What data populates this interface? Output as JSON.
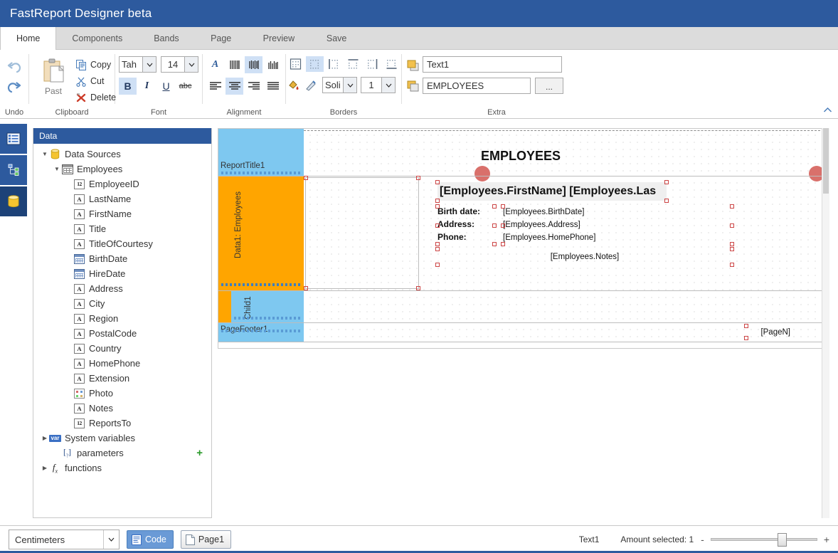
{
  "window": {
    "title": "FastReport Designer beta"
  },
  "tabs": [
    {
      "label": "Home",
      "active": true
    },
    {
      "label": "Components",
      "active": false
    },
    {
      "label": "Bands",
      "active": false
    },
    {
      "label": "Page",
      "active": false
    },
    {
      "label": "Preview",
      "active": false
    },
    {
      "label": "Save",
      "active": false
    }
  ],
  "ribbon": {
    "groups": {
      "undo": {
        "label": "Undo",
        "undo_icon": "undo-arrow-icon",
        "redo_icon": "redo-arrow-icon"
      },
      "clipboard": {
        "label": "Clipboard",
        "paste_label": "Past",
        "items": [
          {
            "label": "Copy",
            "icon": "copy-icon"
          },
          {
            "label": "Cut",
            "icon": "scissors-icon"
          },
          {
            "label": "Delete",
            "icon": "delete-x-icon"
          }
        ]
      },
      "font": {
        "label": "Font",
        "family_value": "Tah",
        "size_value": "14",
        "bold_label": "B",
        "italic_label": "I",
        "underline_label": "U",
        "strike_label": "abc",
        "bold_active": true
      },
      "alignment": {
        "label": "Alignment",
        "rotate_label": "A",
        "vertical": [
          {
            "name": "align-top-icon",
            "active": false
          },
          {
            "name": "align-middle-icon",
            "active": true
          },
          {
            "name": "align-bottom-icon",
            "active": false
          }
        ],
        "horizontal": [
          {
            "name": "align-left-icon",
            "active": false
          },
          {
            "name": "align-center-icon",
            "active": true
          },
          {
            "name": "align-right-icon",
            "active": false
          },
          {
            "name": "align-justify-icon",
            "active": false
          }
        ]
      },
      "borders": {
        "label": "Borders",
        "buttons": [
          {
            "name": "border-all-icon",
            "active": false
          },
          {
            "name": "border-none-icon",
            "active": true
          },
          {
            "name": "border-left-icon",
            "active": false
          },
          {
            "name": "border-top-icon",
            "active": false
          },
          {
            "name": "border-right-icon",
            "active": false
          },
          {
            "name": "border-bottom-icon",
            "active": false
          }
        ],
        "fill_icon": "fill-color-icon",
        "line_color_icon": "line-color-icon",
        "style_value": "Soli",
        "width_value": "1"
      },
      "extra": {
        "label": "Extra",
        "bring_front_icon": "bring-to-front-icon",
        "send_back_icon": "send-to-back-icon",
        "name_value": "Text1",
        "text_value": "EMPLOYEES",
        "ellipsis_label": "..."
      }
    },
    "collapse_icon": "chevron-up-icon"
  },
  "left_strip": [
    {
      "name": "properties-panel-icon",
      "selected": false
    },
    {
      "name": "report-tree-icon",
      "selected": false
    },
    {
      "name": "data-panel-icon",
      "selected": true
    }
  ],
  "data_panel": {
    "header": "Data",
    "tree": [
      {
        "label": "Data Sources",
        "indent": 0,
        "twisty": "down",
        "icon": "database-icon"
      },
      {
        "label": "Employees",
        "indent": 1,
        "twisty": "down",
        "icon": "table-icon"
      },
      {
        "label": "EmployeeID",
        "indent": 2,
        "twisty": "",
        "icon": "number-field-icon"
      },
      {
        "label": "LastName",
        "indent": 2,
        "twisty": "",
        "icon": "text-field-icon"
      },
      {
        "label": "FirstName",
        "indent": 2,
        "twisty": "",
        "icon": "text-field-icon"
      },
      {
        "label": "Title",
        "indent": 2,
        "twisty": "",
        "icon": "text-field-icon"
      },
      {
        "label": "TitleOfCourtesy",
        "indent": 2,
        "twisty": "",
        "icon": "text-field-icon"
      },
      {
        "label": "BirthDate",
        "indent": 2,
        "twisty": "",
        "icon": "date-field-icon"
      },
      {
        "label": "HireDate",
        "indent": 2,
        "twisty": "",
        "icon": "date-field-icon"
      },
      {
        "label": "Address",
        "indent": 2,
        "twisty": "",
        "icon": "text-field-icon"
      },
      {
        "label": "City",
        "indent": 2,
        "twisty": "",
        "icon": "text-field-icon"
      },
      {
        "label": "Region",
        "indent": 2,
        "twisty": "",
        "icon": "text-field-icon"
      },
      {
        "label": "PostalCode",
        "indent": 2,
        "twisty": "",
        "icon": "text-field-icon"
      },
      {
        "label": "Country",
        "indent": 2,
        "twisty": "",
        "icon": "text-field-icon"
      },
      {
        "label": "HomePhone",
        "indent": 2,
        "twisty": "",
        "icon": "text-field-icon"
      },
      {
        "label": "Extension",
        "indent": 2,
        "twisty": "",
        "icon": "text-field-icon"
      },
      {
        "label": "Photo",
        "indent": 2,
        "twisty": "",
        "icon": "image-field-icon"
      },
      {
        "label": "Notes",
        "indent": 2,
        "twisty": "",
        "icon": "text-field-icon"
      },
      {
        "label": "ReportsTo",
        "indent": 2,
        "twisty": "",
        "icon": "number-field-icon"
      },
      {
        "label": "System variables",
        "indent": 0,
        "twisty": "right",
        "icon": "variable-icon"
      },
      {
        "label": "parameters",
        "indent": 1,
        "twisty": "",
        "icon": "parameter-icon",
        "add": "+"
      },
      {
        "label": "functions",
        "indent": 0,
        "twisty": "right",
        "icon": "function-icon"
      }
    ]
  },
  "report": {
    "bands": [
      {
        "name": "ReportTitle1",
        "label": "ReportTitle1",
        "orientation": "horizontal",
        "color": "#7ec8f0"
      },
      {
        "name": "Data1",
        "label": "Data1: Employees",
        "orientation": "vertical",
        "color": "#ffa500"
      },
      {
        "name": "Child1",
        "label": "Child1",
        "orientation": "vertical",
        "color": "#7ec8f0"
      },
      {
        "name": "PageFooter1",
        "label": "PageFooter1",
        "orientation": "horizontal",
        "color": "#7ec8f0"
      }
    ],
    "elements": [
      {
        "name": "report-title-text",
        "text": "EMPLOYEES",
        "style": "title"
      },
      {
        "name": "full-name-text",
        "text": "[Employees.FirstName] [Employees.Las",
        "style": "name"
      },
      {
        "name": "birth-date-label",
        "text": "Birth date:",
        "style": "label"
      },
      {
        "name": "birth-date-value",
        "text": "[Employees.BirthDate]",
        "style": "value"
      },
      {
        "name": "address-label",
        "text": "Address:",
        "style": "label"
      },
      {
        "name": "address-value",
        "text": "[Employees.Address]",
        "style": "value"
      },
      {
        "name": "phone-label",
        "text": "Phone:",
        "style": "label"
      },
      {
        "name": "phone-value",
        "text": "[Employees.HomePhone]",
        "style": "value"
      },
      {
        "name": "notes-value",
        "text": "[Employees.Notes]",
        "style": "value"
      },
      {
        "name": "page-number-text",
        "text": "[PageN]",
        "style": "value"
      }
    ]
  },
  "status_bar": {
    "units_value": "Centimeters",
    "code_tab": "Code",
    "page_tab": "Page1",
    "selected_object": "Text1",
    "amount_selected": "Amount selected: 1",
    "zoom_out": "-",
    "zoom_in": "+"
  }
}
